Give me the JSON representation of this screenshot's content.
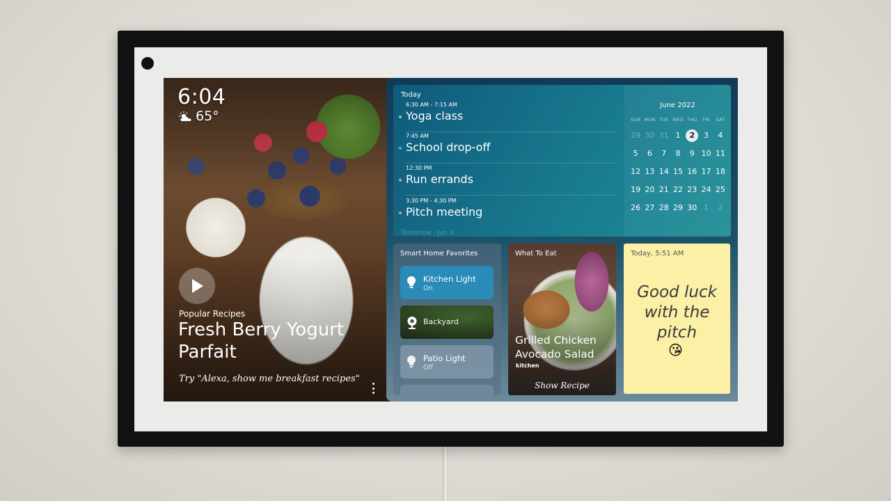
{
  "hero": {
    "clock": "6:04",
    "weather_icon": "partly-sunny-icon",
    "temperature": "65°",
    "category": "Popular Recipes",
    "title": "Fresh Berry Yogurt Parfait",
    "hint": "Try \"Alexa, show me breakfast recipes\""
  },
  "calendar": {
    "today_label": "Today",
    "events": [
      {
        "time": "6:30 AM - 7:15 AM",
        "title": "Yoga class",
        "color": "#8fd37a"
      },
      {
        "time": "7:45 AM",
        "title": "School drop-off",
        "color": "#4fb6e8"
      },
      {
        "time": "12:30 PM",
        "title": "Run errands",
        "color": "#c9a08a"
      },
      {
        "time": "3:30 PM - 4:30 PM",
        "title": "Pitch meeting",
        "color": "#c9a08a"
      }
    ],
    "next_day_label": "Tomorrow · Jun 3",
    "month": {
      "title": "June 2022",
      "weekdays": [
        "SUN",
        "MON",
        "TUE",
        "WED",
        "THU",
        "FRI",
        "SAT"
      ],
      "weeks": [
        [
          "29",
          "30",
          "31",
          "1",
          "2",
          "3",
          "4"
        ],
        [
          "5",
          "6",
          "7",
          "8",
          "9",
          "10",
          "11"
        ],
        [
          "12",
          "13",
          "14",
          "15",
          "16",
          "17",
          "18"
        ],
        [
          "19",
          "20",
          "21",
          "22",
          "23",
          "24",
          "25"
        ],
        [
          "26",
          "27",
          "28",
          "29",
          "30",
          "1",
          "2"
        ]
      ],
      "today": "2"
    }
  },
  "smart_home": {
    "title": "Smart Home Favorites",
    "devices": [
      {
        "name": "Kitchen Light",
        "state": "On",
        "icon": "light-bulb-icon"
      },
      {
        "name": "Backyard",
        "state": "",
        "icon": "camera-icon"
      },
      {
        "name": "Patio Light",
        "state": "Off",
        "icon": "light-bulb-icon"
      }
    ]
  },
  "what_to_eat": {
    "label": "What To Eat",
    "title": "Grilled Chicken Avocado Salad",
    "brand": "kitchen",
    "action": "Show Recipe"
  },
  "sticky_note": {
    "timestamp": "Today, 5:51 AM",
    "text": "Good luck with the pitch",
    "emoji": "😘"
  }
}
